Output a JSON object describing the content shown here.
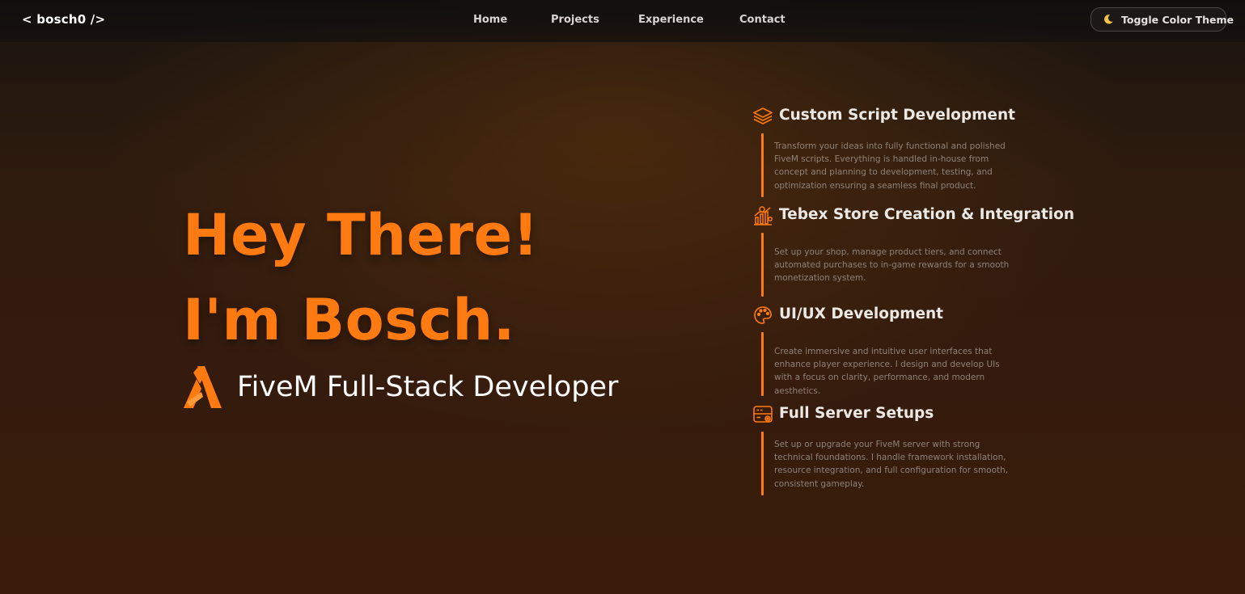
{
  "header": {
    "logo": "< bosch0 />",
    "nav": {
      "home": "Home",
      "projects": "Projects",
      "experience": "Experience",
      "contact": "Contact"
    },
    "theme_toggle": {
      "label": "Toggle Color Theme",
      "icon": "moon-icon"
    }
  },
  "hero": {
    "line1": "Hey There!",
    "line2": "I'm Bosch.",
    "role_icon": "fivem-logo-icon",
    "role": "FiveM Full-Stack Developer"
  },
  "services": [
    {
      "icon": "layers-icon",
      "title": "Custom Script Development",
      "description": "Transform your ideas into fully functional and polished FiveM scripts. Everything is handled in-house from concept and planning to development, testing, and optimization ensuring a seamless final product."
    },
    {
      "icon": "store-chart-icon",
      "title": "Tebex Store Creation & Integration",
      "description": "Set up your shop, manage product tiers, and connect automated purchases to in-game rewards for a smooth monetization system."
    },
    {
      "icon": "palette-icon",
      "title": "UI/UX Development",
      "description": "Create immersive and intuitive user interfaces that enhance player experience. I design and develop UIs with a focus on clarity, performance, and modern aesthetics."
    },
    {
      "icon": "server-settings-icon",
      "title": "Full Server Setups",
      "description": "Set up or upgrade your FiveM server with strong technical foundations. I handle framework installation, resource integration, and full configuration for smooth, consistent gameplay."
    }
  ],
  "colors": {
    "accent": "#ff7a10",
    "background": "#2e1b0e",
    "text_muted": "#8f8278"
  }
}
